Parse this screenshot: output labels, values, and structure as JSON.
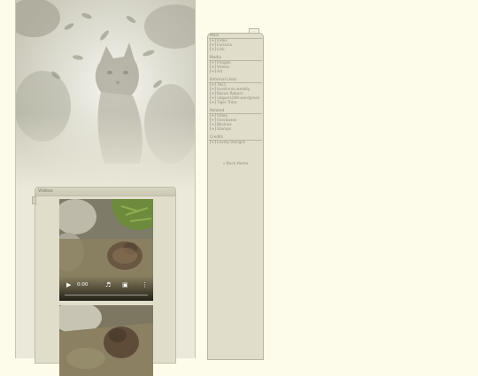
{
  "header_image": {
    "subject": "wild-cat-photo"
  },
  "videos": {
    "title": "Videos",
    "player": {
      "time": "0:00",
      "icons": [
        "play-icon",
        "volume-icon",
        "fullscreen-icon",
        "more-options-icon"
      ]
    }
  },
  "sidebar": {
    "tab_label": "····",
    "sections": [
      {
        "title": "Main",
        "items": [
          "Index",
          "Fursona",
          "Link"
        ]
      },
      {
        "title": "Media",
        "items": [
          "Images",
          "Videos",
          "Art"
        ]
      },
      {
        "title": "External Links",
        "items": [
          "TSCC",
          "lovelinnie.weebly",
          "Bacon Reborn",
          "ratgurls169.wordpress",
          "Tiger Tribe"
        ]
      },
      {
        "title": "Related",
        "items": [
          "Video",
          "Userboxes",
          "Blinkies",
          "Stamps"
        ]
      },
      {
        "title": "Credits",
        "items": [
          "Lovely Designs"
        ]
      }
    ],
    "bracket": "[+]",
    "back_home": "« Back Home"
  },
  "colors": {
    "page_bg": "#fdfbe9",
    "panel_bg": "#e0ddcb",
    "border": "#b8b6a3",
    "text": "#8a8a7a"
  }
}
